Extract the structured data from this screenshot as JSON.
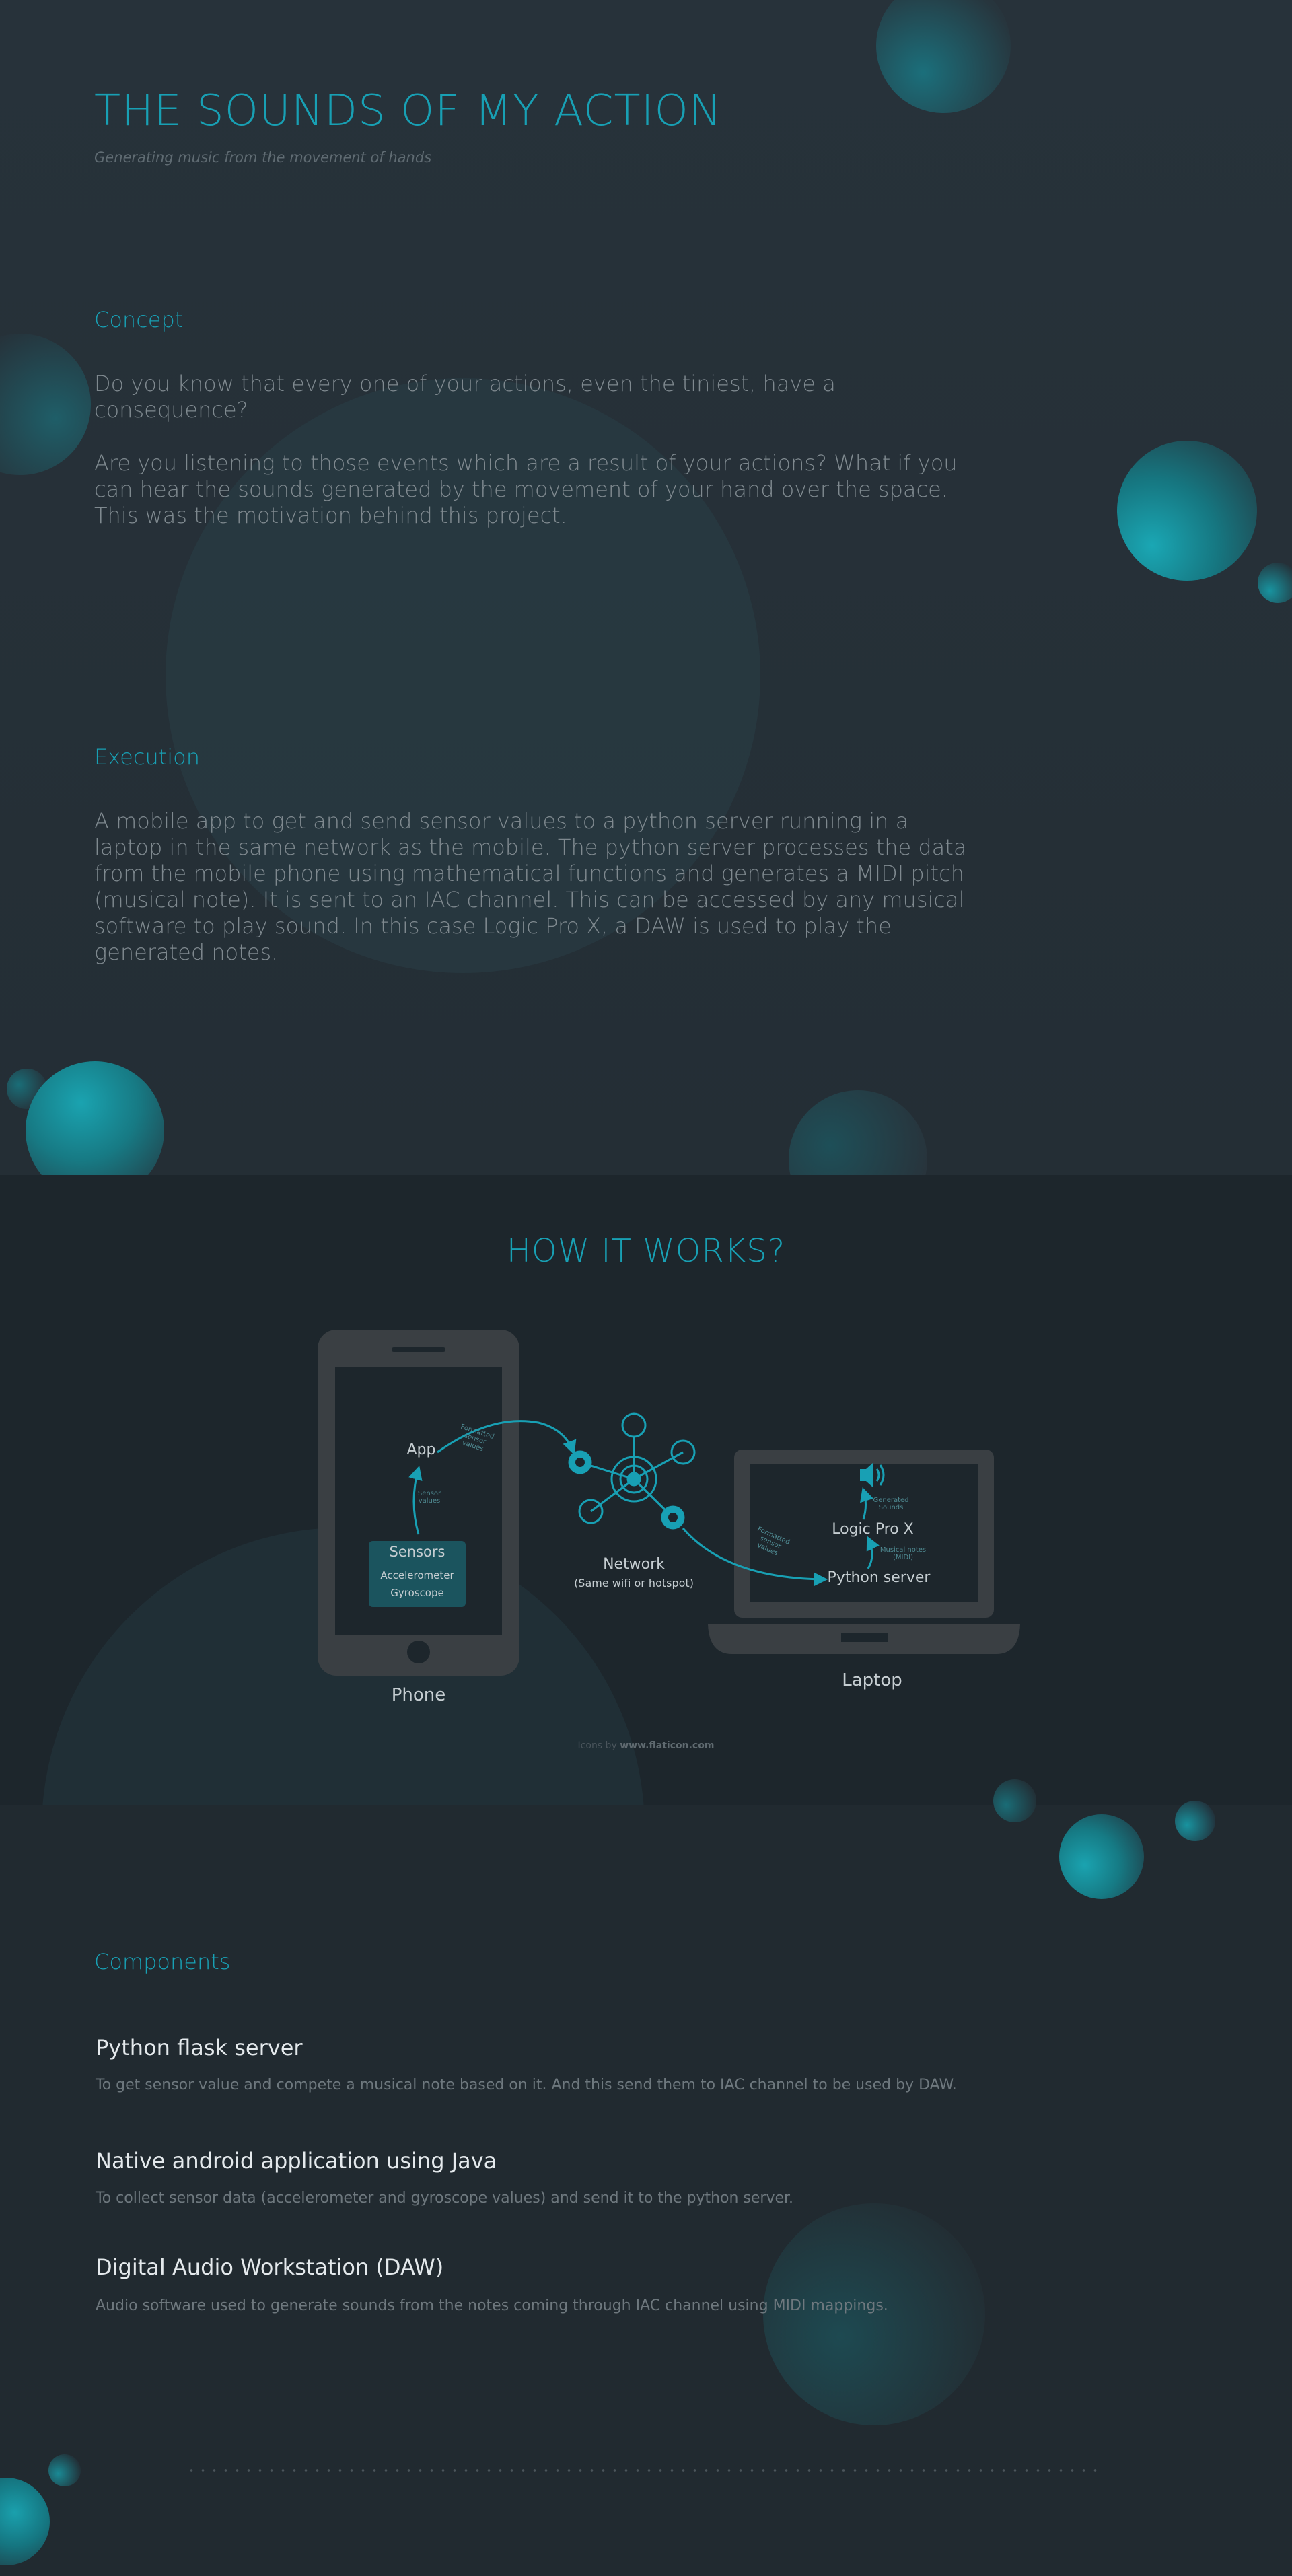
{
  "hero": {
    "title": "THE SOUNDS OF MY ACTION",
    "subtitle": "Generating music from the movement of hands"
  },
  "concept": {
    "heading": "Concept",
    "paragraph_1": "Do you know that every one of your actions, even the tiniest, have a consequence?",
    "paragraph_2": "Are you listening to those events which are a result of your actions? What if you can hear the sounds generated by the movement of your hand over the space. This was the motivation behind this project."
  },
  "execution": {
    "heading": "Execution",
    "paragraph": "A mobile app to get and send sensor values to a python server running in a laptop in the same network as the mobile. The python server processes the data from the mobile phone using mathematical functions and generates a MIDI pitch (musical note). It is sent to an IAC channel. This can be accessed by any musical software to play sound. In this case Logic Pro X, a DAW is used to play the generated notes."
  },
  "how_it_works": {
    "title": "HOW IT WORKS?",
    "phone_label": "Phone",
    "app_label": "App",
    "sensors_title": "Sensors",
    "sensor_1": "Accelerometer",
    "sensor_2": "Gyroscope",
    "sensor_values_note": "Sensor values",
    "formatted_values_note": "Formatted sensor values",
    "network_label": "Network",
    "network_sub": "(Same wifi or hotspot)",
    "laptop_label": "Laptop",
    "laptop_formatted_note": "Formatted sensor values",
    "python_server_label": "Python server",
    "midi_note": "Musical notes (MIDI)",
    "logic_label": "Logic Pro X",
    "generated_sounds_note": "Generated Sounds",
    "credit_prefix": "Icons by ",
    "credit_link": "www.flaticon.com",
    "icons": [
      "phone-icon",
      "network-hub-icon",
      "laptop-icon",
      "speaker-icon"
    ]
  },
  "components": {
    "heading": "Components",
    "items": [
      {
        "title": "Python flask server",
        "description": "To get sensor value and compete a musical note based on it. And this send them to IAC channel to be used by DAW."
      },
      {
        "title": "Native android application using Java",
        "description": "To collect sensor data (accelerometer and gyroscope values) and send it to the python server."
      },
      {
        "title": "Digital Audio Workstation (DAW)",
        "description": "Audio software used to generate sounds from the notes coming through IAC channel using MIDI mappings."
      }
    ]
  },
  "colors": {
    "accent": "#18a0b4",
    "background": "#242e35",
    "panel": "#1d262c",
    "device": "#3a3f43"
  }
}
